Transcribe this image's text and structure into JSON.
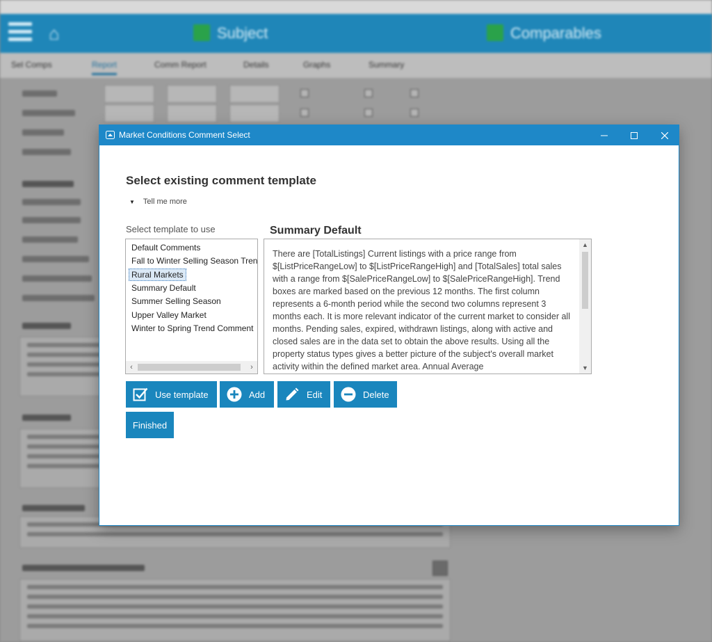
{
  "background": {
    "window_title": "",
    "header": {
      "tab_subject": "Subject",
      "tab_comparables": "Comparables"
    },
    "subtabs": [
      "Sel Comps",
      "Report",
      "Comm Report",
      "Details",
      "Graphs",
      "Summary"
    ]
  },
  "dialog": {
    "title": "Market Conditions Comment Select",
    "heading": "Select existing comment template",
    "tell_me_more": "Tell me more",
    "list_label": "Select template to use",
    "templates": [
      "Default Comments",
      "Fall to Winter Selling Season Trends",
      "Rural Markets",
      "Summary Default",
      "Summer Selling Season",
      "Upper Valley Market",
      "Winter to Spring Trend Comment"
    ],
    "selected_template": "Rural Markets",
    "preview_title": "Summary Default",
    "preview_text": "There are [TotalListings] Current listings with a price range from $[ListPriceRangeLow] to $[ListPriceRangeHigh] and [TotalSales] total sales with a range from $[SalePriceRangeLow] to $[SalePriceRangeHigh]. Trend boxes are marked based on the previous 12 months. The first column represents a 6-month period while the second two columns represent 3 months each. It is more relevant indicator of the current market to consider all months. Pending sales, expired, withdrawn listings, along with active and closed sales are in the data set to obtain the above results. Using all the property status types gives a better picture of the subject's overall market activity within the defined market area. Annual Average",
    "buttons": {
      "use_template": "Use template",
      "add": "Add",
      "edit": "Edit",
      "delete": "Delete",
      "finished": "Finished"
    }
  },
  "colors": {
    "accent": "#1e88c8",
    "button": "#1a86bd",
    "header_bg": "#1f86b8",
    "status_green": "#2aa24a"
  }
}
